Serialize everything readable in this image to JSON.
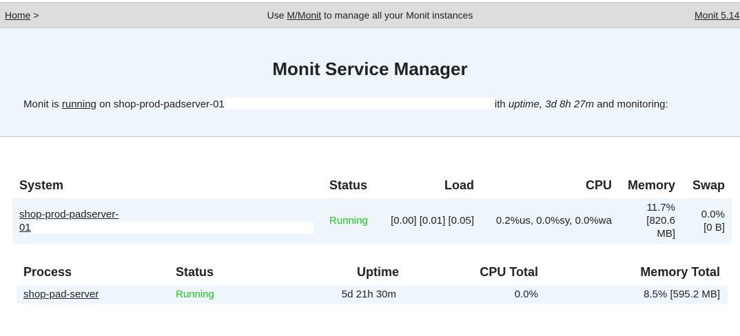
{
  "topbar": {
    "home_link": "Home",
    "home_sep": " >",
    "center_prefix": "Use ",
    "center_link": "M/Monit",
    "center_suffix": " to manage all your Monit instances",
    "version_link": "Monit 5.14"
  },
  "header": {
    "title": "Monit Service Manager",
    "status_prefix": "Monit is ",
    "status_link": "running",
    "status_on": " on shop-prod-padserver-01",
    "status_uptime_prefix": "ith ",
    "status_uptime_label": "uptime, 3d 8h 27m",
    "status_suffix": "  and monitoring:"
  },
  "system_table": {
    "headers": {
      "system": "System",
      "status": "Status",
      "load": "Load",
      "cpu": "CPU",
      "memory": "Memory",
      "swap": "Swap"
    },
    "row": {
      "name_line1": "shop-prod-padserver-",
      "name_line2": "01",
      "status": "Running",
      "load": "[0.00] [0.01] [0.05]",
      "cpu": "0.2%us, 0.0%sy, 0.0%wa",
      "memory_line1": "11.7%",
      "memory_line2": "[820.6",
      "memory_line3": "MB]",
      "swap_line1": "0.0%",
      "swap_line2": "[0 B]"
    }
  },
  "process_table": {
    "headers": {
      "process": "Process",
      "status": "Status",
      "uptime": "Uptime",
      "cpu_total": "CPU Total",
      "memory_total": "Memory Total"
    },
    "rows": [
      {
        "name": "shop-pad-server",
        "status": "Running",
        "uptime": "5d 21h 30m",
        "cpu_total": "0.0%",
        "memory_total": "8.5% [595.2 MB]"
      }
    ]
  },
  "colors": {
    "running": "#19cc19",
    "header_bg": "#eef5fb",
    "topbar_bg": "#dddddd"
  }
}
